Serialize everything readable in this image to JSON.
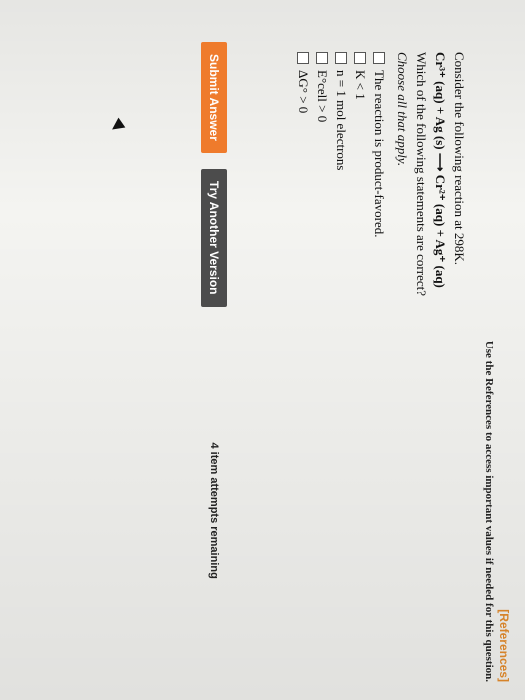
{
  "references": {
    "label": "[References]"
  },
  "notice": "Use the References to access important values if needed for this question.",
  "question": {
    "intro": "Consider the following reaction at 298K.",
    "equation": "Cr³⁺ (aq) + Ag (s) ⟶ Cr²⁺ (aq) + Ag⁺ (aq)",
    "prompt": "Which of the following statements are correct?",
    "instruction": "Choose all that apply."
  },
  "choices": [
    {
      "label": "The reaction is product-favored."
    },
    {
      "label": "K < 1"
    },
    {
      "label": "n = 1 mol electrons"
    },
    {
      "label": "E°cell > 0"
    },
    {
      "label": "ΔG° > 0"
    }
  ],
  "buttons": {
    "submit": "Submit Answer",
    "try": "Try Another Version"
  },
  "attempts": "4 item attempts remaining"
}
